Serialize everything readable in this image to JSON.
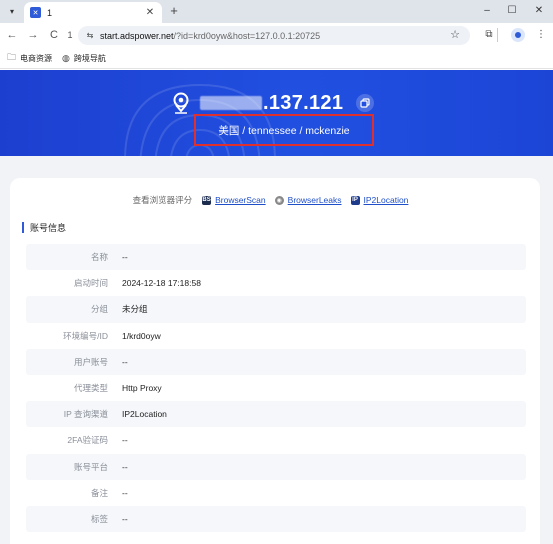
{
  "browser": {
    "tab_title": "1",
    "url_host": "start.adspower.net",
    "url_rest": "/?id=krd0oyw&host=127.0.0.1:20725",
    "bookmarks": [
      {
        "label": "电商资源",
        "icon": "folder-icon"
      },
      {
        "label": "跨境导航",
        "icon": "globe-icon"
      }
    ]
  },
  "hero": {
    "ip_visible": ".137.121",
    "location": "美国 / tennessee / mckenzie"
  },
  "score": {
    "label": "查看浏览器评分",
    "links": [
      {
        "label": "BrowserScan",
        "icon": "browserscan-icon",
        "color": "#1b2b4d",
        "glyph": "BS"
      },
      {
        "label": "BrowserLeaks",
        "icon": "browserleaks-icon",
        "color": "#888888",
        "glyph": "◉"
      },
      {
        "label": "IP2Location",
        "icon": "ip2location-icon",
        "color": "#1e3a8a",
        "glyph": "IP"
      }
    ]
  },
  "section": {
    "title": "账号信息"
  },
  "rows": [
    {
      "label": "名称",
      "value": "--"
    },
    {
      "label": "启动时间",
      "value": "2024-12-18 17:18:58"
    },
    {
      "label": "分组",
      "value": "未分组"
    },
    {
      "label": "环境编号/ID",
      "value": "1/krd0oyw"
    },
    {
      "label": "用户账号",
      "value": "--"
    },
    {
      "label": "代理类型",
      "value": "Http Proxy"
    },
    {
      "label": "IP 查询渠道",
      "value": "IP2Location"
    },
    {
      "label": "2FA验证码",
      "value": "--"
    },
    {
      "label": "账号平台",
      "value": "--"
    },
    {
      "label": "备注",
      "value": "--"
    },
    {
      "label": "标签",
      "value": "--"
    }
  ],
  "colors": {
    "hero_blue": "#2150e0",
    "highlight_red": "#e0302e",
    "link_blue": "#1f4fc8"
  }
}
